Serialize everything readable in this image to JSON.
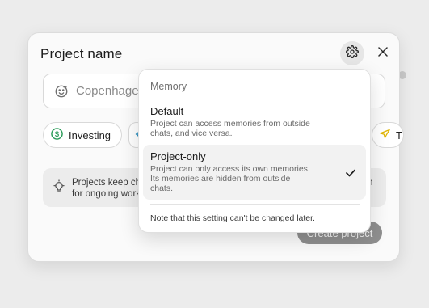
{
  "dialog": {
    "title": "Project name",
    "name_input": {
      "value": "Copenhagen"
    },
    "chips": [
      {
        "label": "Investing",
        "icon": "dollar-icon",
        "color": "#2e9d5b"
      },
      {
        "label": "T",
        "icon": "plane-icon",
        "color": "#e0b400"
      }
    ],
    "info": {
      "line1": "Projects keep ch",
      "line2": "for ongoing work",
      "trail": "n"
    },
    "create_button_label": "Create project"
  },
  "memory_menu": {
    "header": "Memory",
    "options": [
      {
        "title": "Default",
        "desc_line1": "Project can access memories from outside",
        "desc_line2": "chats, and vice versa.",
        "selected": false
      },
      {
        "title": "Project-only",
        "desc_line1": "Project can only access its own memories.",
        "desc_line2": "Its memories are hidden from outside",
        "desc_line3": "chats.",
        "selected": true
      }
    ],
    "note": "Note that this setting can't be changed later."
  },
  "colors": {
    "accent_green": "#2e9d5b",
    "accent_yellow": "#e0b400",
    "partial_chip_icon": "#2a8fbf"
  }
}
